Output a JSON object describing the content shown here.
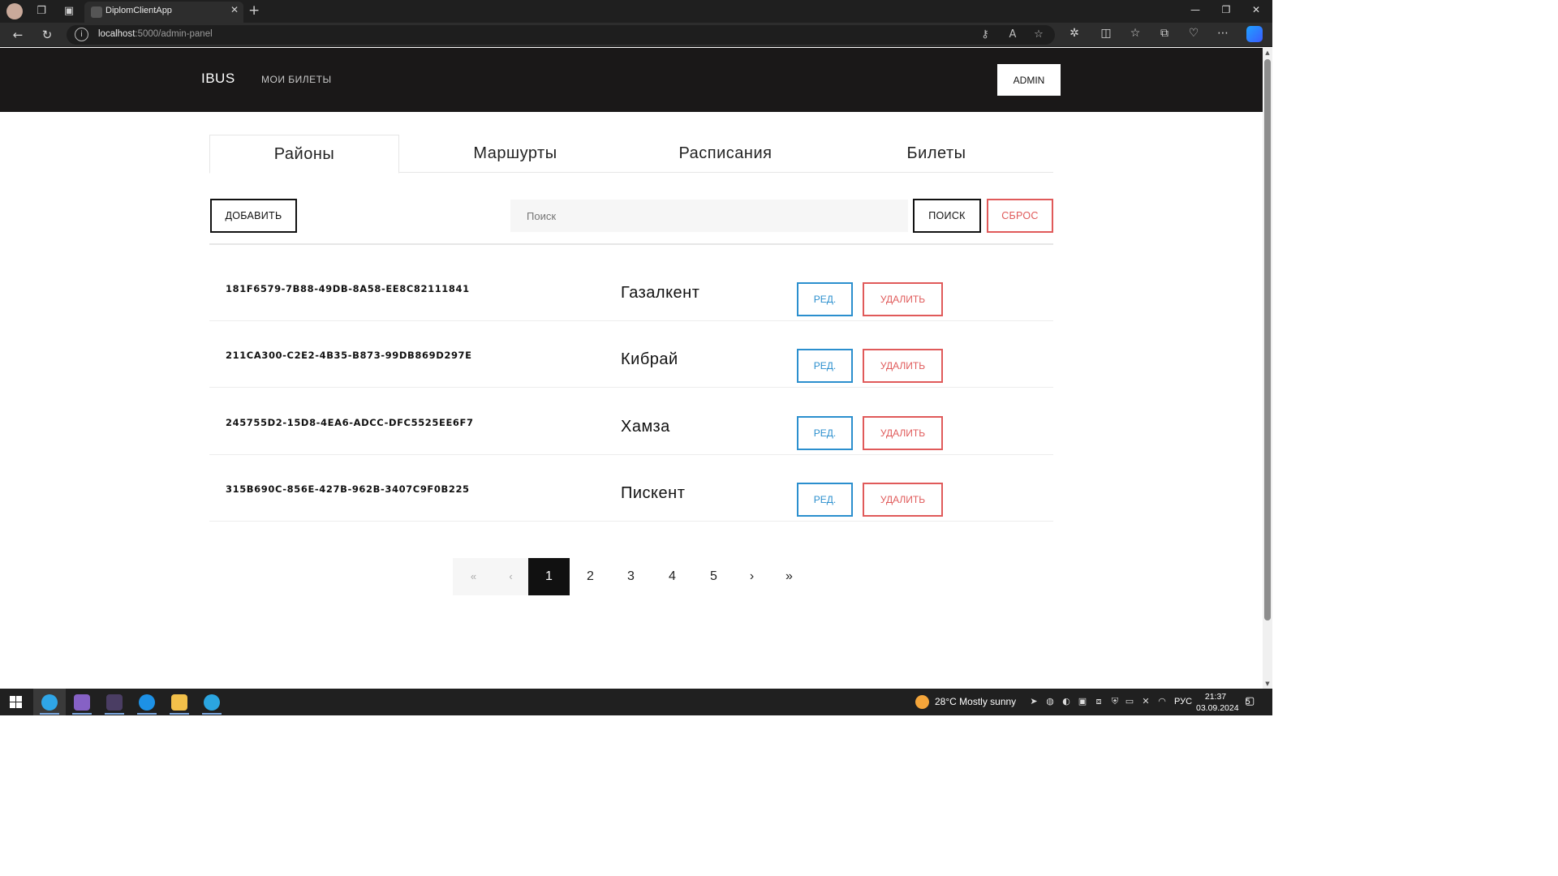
{
  "browser": {
    "tab_title": "DiplomClientApp",
    "url_host": "localhost",
    "url_rest": ":5000/admin-panel"
  },
  "header": {
    "brand": "IBUS",
    "nav_link": "МОИ БИЛЕТЫ",
    "admin_button": "ADMIN"
  },
  "tabs": [
    {
      "label": "Районы",
      "active": true
    },
    {
      "label": "Маршурты",
      "active": false
    },
    {
      "label": "Расписания",
      "active": false
    },
    {
      "label": "Билеты",
      "active": false
    }
  ],
  "toolbar": {
    "add_label": "ДОБАВИТЬ",
    "search_placeholder": "Поиск",
    "search_label": "ПОИСК",
    "reset_label": "СБРОС"
  },
  "rows": [
    {
      "id": "181F6579-7B88-49DB-8A58-EE8C82111841",
      "name": "Газалкент",
      "edit": "РЕД.",
      "delete": "УДАЛИТЬ"
    },
    {
      "id": "211CA300-C2E2-4B35-B873-99DB869D297E",
      "name": "Кибрай",
      "edit": "РЕД.",
      "delete": "УДАЛИТЬ"
    },
    {
      "id": "245755D2-15D8-4EA6-ADCC-DFC5525EE6F7",
      "name": "Хамза",
      "edit": "РЕД.",
      "delete": "УДАЛИТЬ"
    },
    {
      "id": "315B690C-856E-427B-962B-3407C9F0B225",
      "name": "Пискент",
      "edit": "РЕД.",
      "delete": "УДАЛИТЬ"
    }
  ],
  "pagination": {
    "first": "«",
    "prev": "‹",
    "pages": [
      "1",
      "2",
      "3",
      "4",
      "5"
    ],
    "current": "1",
    "next": "›",
    "last": "»"
  },
  "taskbar": {
    "weather": "28°C  Mostly sunny",
    "language": "РУС",
    "time": "21:37",
    "date": "03.09.2024",
    "notifications": "5"
  },
  "colors": {
    "header_bg": "#1a1818",
    "edit_blue": "#2b8fce",
    "delete_red": "#e05a5a"
  }
}
